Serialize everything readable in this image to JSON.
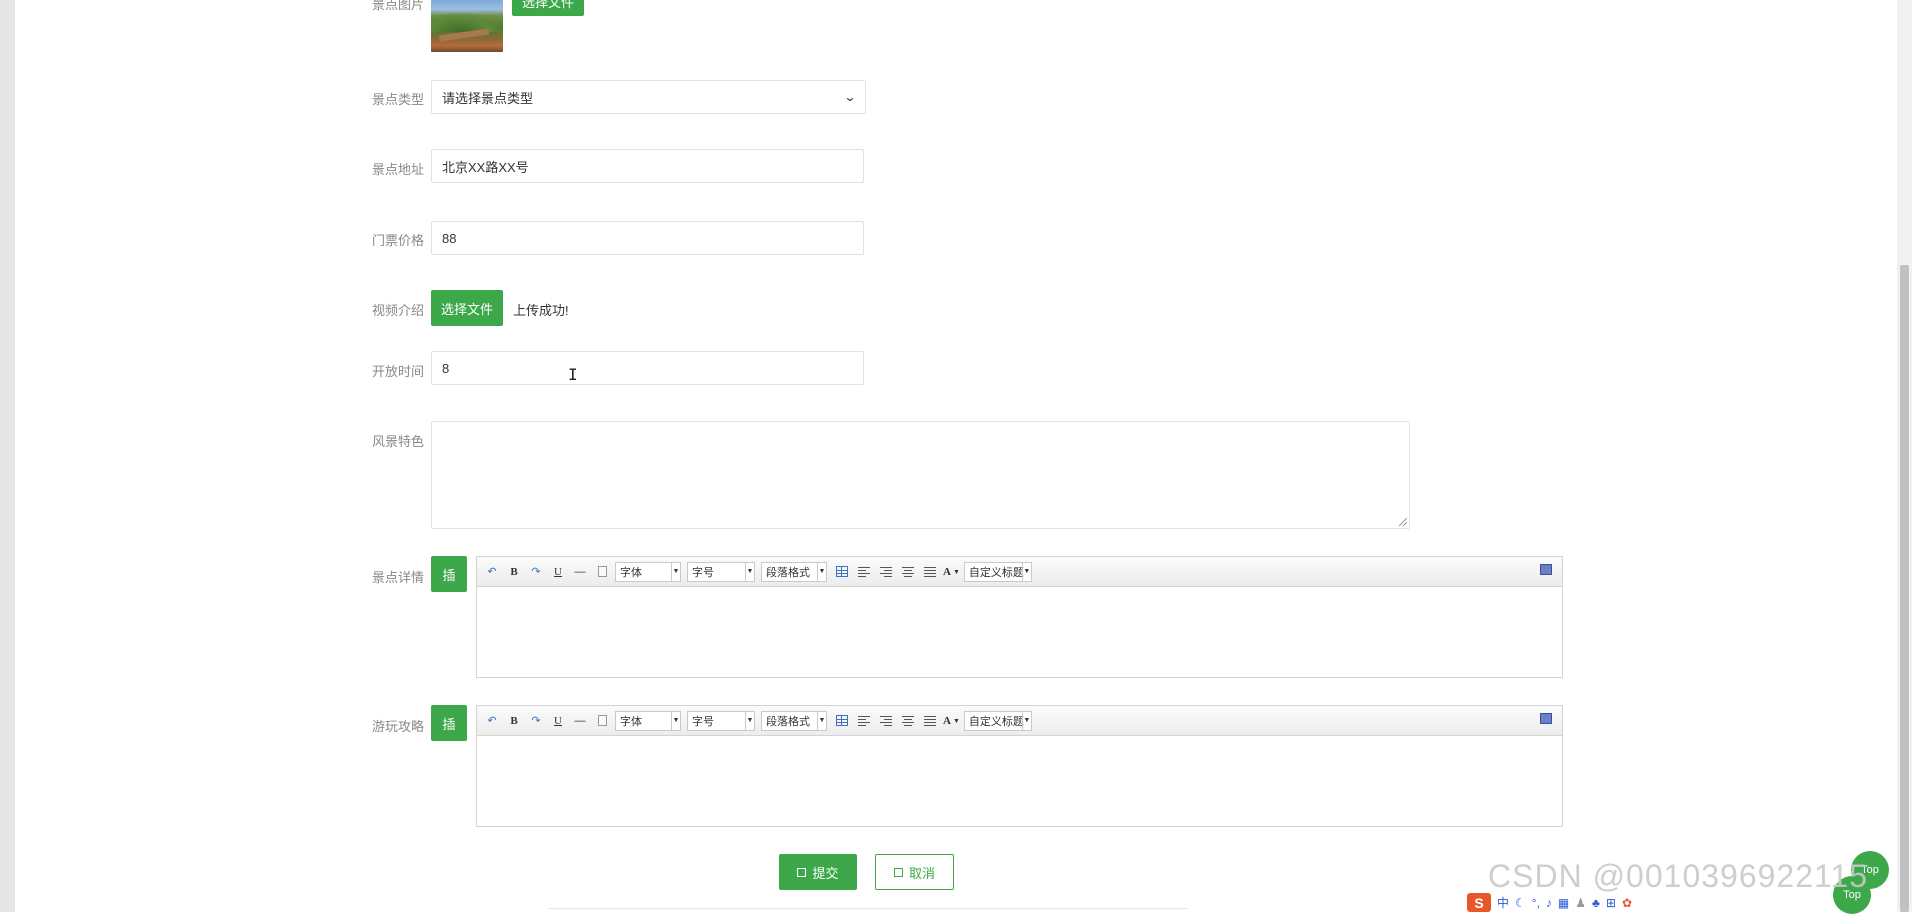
{
  "form": {
    "image_field": {
      "label": "景点图片",
      "button_label": "选择文件"
    },
    "type_field": {
      "label": "景点类型",
      "selected": "请选择景点类型"
    },
    "address_field": {
      "label": "景点地址",
      "value": "北京XX路XX号"
    },
    "price_field": {
      "label": "门票价格",
      "value": "88"
    },
    "video_field": {
      "label": "视频介绍",
      "button_label": "选择文件",
      "status": "上传成功!"
    },
    "opening_field": {
      "label": "开放时间",
      "value": "8"
    },
    "feature_field": {
      "label": "风景特色",
      "value": ""
    },
    "detail_field": {
      "label": "景点详情",
      "insert_label": "插"
    },
    "guide_field": {
      "label": "游玩攻略",
      "insert_label": "插"
    }
  },
  "editor_toolbar": {
    "font_label": "字体",
    "size_label": "字号",
    "paragraph_label": "段落格式",
    "custom_label": "自定义标题",
    "bold": "B",
    "underline": "U",
    "color_letter": "A"
  },
  "actions": {
    "submit_label": "提交",
    "cancel_label": "取消"
  },
  "top_buttons": {
    "label": "Top"
  },
  "watermark": "CSDN @0010396922115",
  "ime": {
    "mode": "中",
    "logo": "S"
  },
  "colors": {
    "accent": "#3ca84a",
    "label": "#888888",
    "border": "#e2e2e2"
  }
}
